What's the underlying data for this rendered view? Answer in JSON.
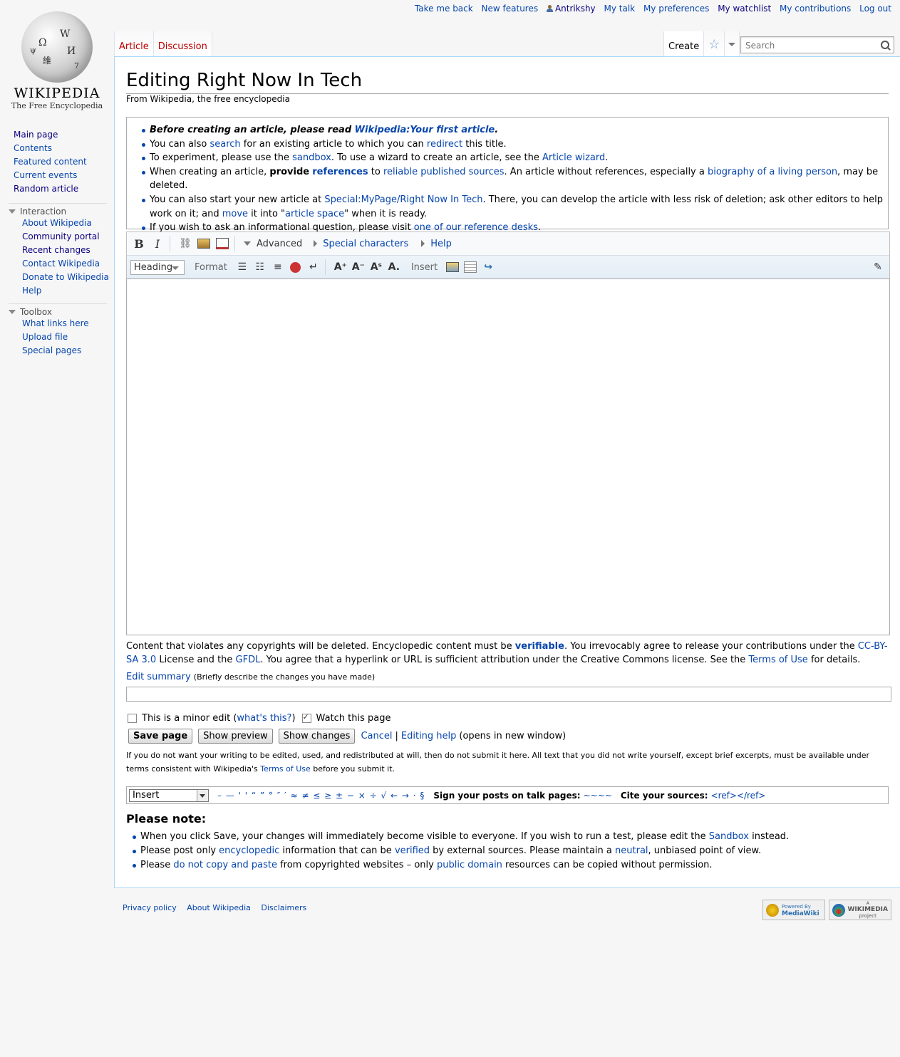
{
  "personal": {
    "take_me_back": "Take me back",
    "new_features": "New features",
    "username": "Antrikshy",
    "my_talk": "My talk",
    "my_preferences": "My preferences",
    "my_watchlist": "My watchlist",
    "my_contributions": "My contributions",
    "log_out": "Log out"
  },
  "logo": {
    "wordmark": "WIKIPEDIA",
    "tagline": "The Free Encyclopedia"
  },
  "sidebar": {
    "nav": [
      "Main page",
      "Contents",
      "Featured content",
      "Current events",
      "Random article"
    ],
    "interaction_heading": "Interaction",
    "interaction": [
      "About Wikipedia",
      "Community portal",
      "Recent changes",
      "Contact Wikipedia",
      "Donate to Wikipedia",
      "Help"
    ],
    "toolbox_heading": "Toolbox",
    "toolbox": [
      "What links here",
      "Upload file",
      "Special pages"
    ]
  },
  "tabs": {
    "article": "Article",
    "discussion": "Discussion",
    "create": "Create"
  },
  "search": {
    "placeholder": "Search"
  },
  "page": {
    "title": "Editing Right Now In Tech",
    "subtitle": "From Wikipedia, the free encyclopedia"
  },
  "notice": {
    "l1a": "Before creating an article, please read ",
    "l1link": "Wikipedia:Your first article",
    "l1b": ".",
    "l2a": "You can also ",
    "l2search": "search",
    "l2b": " for an existing article to which you can ",
    "l2redirect": "redirect",
    "l2c": " this title.",
    "l3a": "To experiment, please use the ",
    "l3sandbox": "sandbox",
    "l3b": ". To use a wizard to create an article, see the ",
    "l3wizard": "Article wizard",
    "l3c": ".",
    "l4a": "When creating an article, ",
    "l4provide": "provide",
    "l4refs": "references",
    "l4b": " to ",
    "l4sources": "reliable published sources",
    "l4c": ". An article without references, especially a ",
    "l4blp": "biography of a living person",
    "l4d": ", may be deleted.",
    "l5a": "You can also start your new article at ",
    "l5link": "Special:MyPage/Right Now In Tech",
    "l5b": ". There, you can develop the article with less risk of deletion; ask other editors to help work on it; and ",
    "l5move": "move",
    "l5c": " it into \"",
    "l5space": "article space",
    "l5d": "\" when it is ready.",
    "l6a": "If you wish to ask an informational question, please visit ",
    "l6link": "one of our reference desks",
    "l6b": "."
  },
  "toolbar": {
    "advanced": "Advanced",
    "special_characters": "Special characters",
    "help": "Help",
    "heading": "Heading",
    "format": "Format",
    "insert": "Insert"
  },
  "copywarn": {
    "a": "Content that violates any copyrights will be deleted. Encyclopedic content must be ",
    "verifiable": "verifiable",
    "b": ". You irrevocably agree to release your contributions under the ",
    "ccbysa": "CC-BY-SA 3.0",
    "c": " License and the ",
    "gfdl": "GFDL",
    "d": ". You agree that a hyperlink or URL is sufficient attribution under the Creative Commons license. See the ",
    "tou": "Terms of Use",
    "e": " for details."
  },
  "summary": {
    "label": "Edit summary",
    "hint": "(Briefly describe the changes you have made)"
  },
  "options": {
    "minor": "This is a minor edit (",
    "whats_this": "what's this?",
    "minor_end": ")",
    "watch": "Watch this page"
  },
  "buttons": {
    "save": "Save page",
    "preview": "Show preview",
    "changes": "Show changes",
    "cancel": "Cancel",
    "sep": "|",
    "editing_help": "Editing help",
    "new_window": "(opens in new window)"
  },
  "license": {
    "a": "If you do not want your writing to be edited, used, and redistributed at will, then do not submit it here. All text that you did not write yourself, except brief excerpts, must be available under terms consistent with Wikipedia's ",
    "tou": "Terms of Use",
    "b": " before you submit it."
  },
  "charinsert": {
    "selected": "Insert",
    "chars": "– — ' ' “ ” ° ″ ′ ≈ ≠ ≤ ≥ ± − × ÷ √ ← → · §",
    "sign_label": "Sign your posts on talk pages:",
    "sign_value": "~~~~",
    "cite_label": "Cite your sources:",
    "cite_value": "<ref></ref>"
  },
  "note": {
    "heading": "Please note:",
    "n1a": "When you click Save, your changes will immediately become visible to everyone. If you wish to run a test, please edit the ",
    "n1link": "Sandbox",
    "n1b": " instead.",
    "n2a": "Please post only ",
    "n2enc": "encyclopedic",
    "n2b": " information that can be ",
    "n2ver": "verified",
    "n2c": " by external sources. Please maintain a ",
    "n2neu": "neutral",
    "n2d": ", unbiased point of view.",
    "n3a": "Please ",
    "n3copy": "do not copy and paste",
    "n3b": " from copyrighted websites – only ",
    "n3pd": "public domain",
    "n3c": " resources can be copied without permission."
  },
  "footer": {
    "privacy": "Privacy policy",
    "about": "About Wikipedia",
    "disclaimers": "Disclaimers",
    "mediawiki_top": "Powered By",
    "mediawiki": "MediaWiki",
    "wikimedia_top": "A",
    "wikimedia": "WIKIMEDIA",
    "wikimedia_bottom": "project"
  }
}
